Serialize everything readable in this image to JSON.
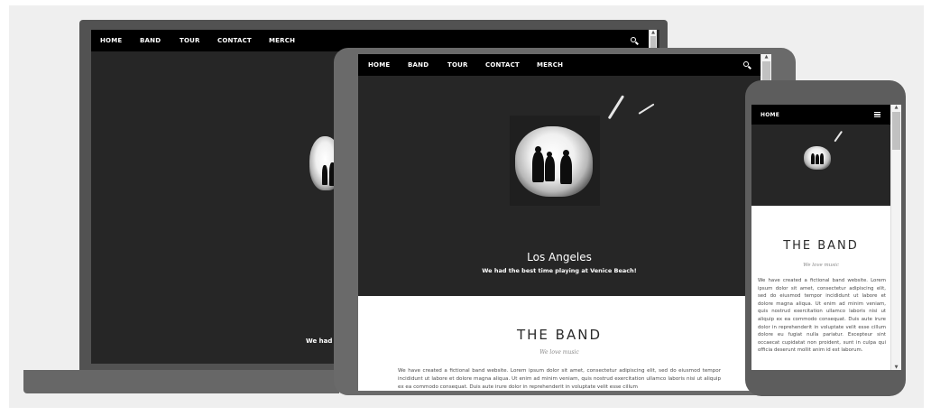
{
  "nav": {
    "items": [
      "HOME",
      "BAND",
      "TOUR",
      "CONTACT",
      "MERCH"
    ],
    "search_icon": "search-icon",
    "menu_icon": "hamburger-icon"
  },
  "hero": {
    "city": "Los Angeles",
    "caption": "We had the best time playing at Venice Beach!",
    "laptop_caption_partial": "We had th"
  },
  "band": {
    "title": "THE BAND",
    "subtitle": "We love music",
    "tablet_text": "We have created a fictional band website. Lorem ipsum dolor sit amet, consectetur adipiscing elit, sed do eiusmod tempor incididunt ut labore et dolore magna aliqua. Ut enim ad minim veniam, quis nostrud exercitation ullamco laboris nisi ut aliquip ex ea commodo consequat. Duis aute irure dolor in reprehenderit in voluptate velit esse cillum",
    "phone_text": "We have created a fictional band website. Lorem ipsum dolor sit amet, consectetur adipiscing elit, sed do eiusmod tempor incididunt ut labore et dolore magna aliqua. Ut enim ad minim veniam, quis nostrud exercitation ullamco laboris nisi ut aliquip ex ea commodo consequat. Duis aute irure dolor in reprehenderit in voluptate velit esse cillum dolore eu fugiat nulla pariatur. Excepteur sint occaecat cupidatat non proident, sunt in culpa qui officia deserunt mollit anim id est laborum."
  },
  "colors": {
    "navbar": "#000000",
    "hero_bg": "#262626",
    "device_frame": "#5d5d5d"
  }
}
